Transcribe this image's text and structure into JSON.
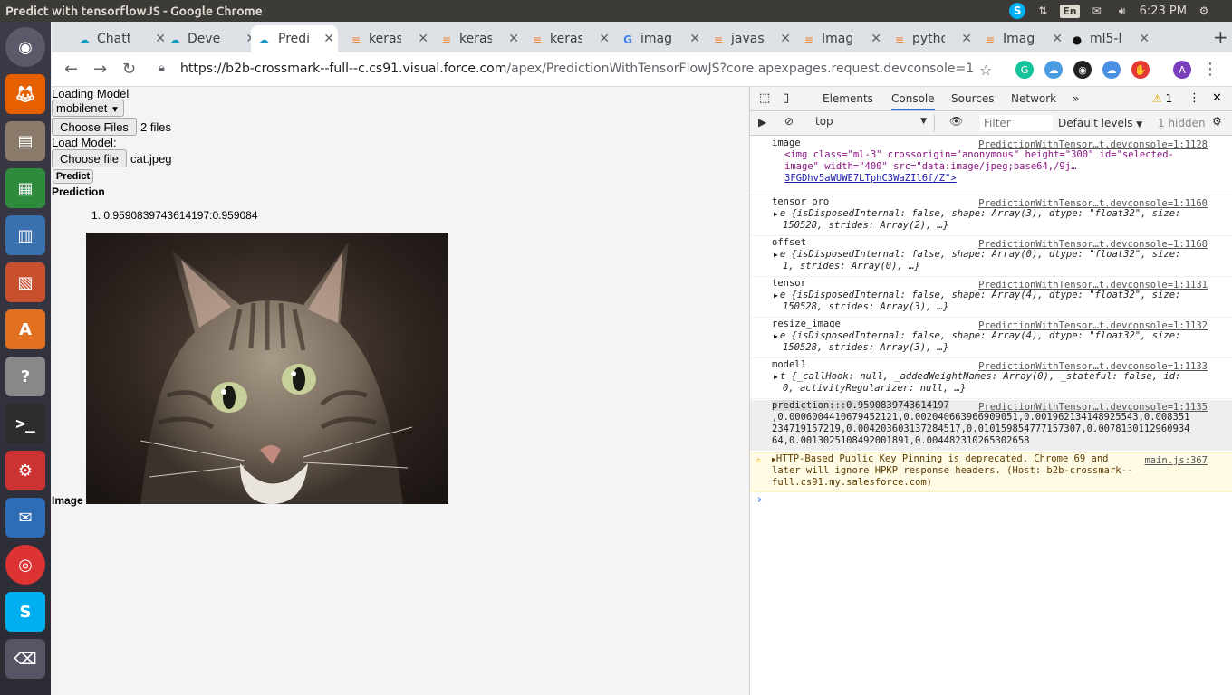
{
  "window": {
    "title": "Predict with tensorflowJS - Google Chrome"
  },
  "tray": {
    "time": "6:23 PM",
    "keyboard": "En"
  },
  "tabs": [
    {
      "label": "Chatt",
      "icon": "salesforce-icon"
    },
    {
      "label": "Deve",
      "icon": "salesforce-icon"
    },
    {
      "label": "Predi",
      "icon": "salesforce-icon"
    },
    {
      "label": "keras",
      "icon": "stackoverflow-icon"
    },
    {
      "label": "keras",
      "icon": "stackoverflow-icon"
    },
    {
      "label": "keras",
      "icon": "stackoverflow-icon"
    },
    {
      "label": "imag",
      "icon": "google-icon"
    },
    {
      "label": "javas",
      "icon": "stackoverflow-icon"
    },
    {
      "label": "Imag",
      "icon": "stackoverflow-icon"
    },
    {
      "label": "pytho",
      "icon": "stackoverflow-icon"
    },
    {
      "label": "Imag",
      "icon": "stackoverflow-icon"
    },
    {
      "label": "ml5-l",
      "icon": "github-icon"
    }
  ],
  "address": {
    "host": "https://b2b-crossmark--full--c.cs91.visual.force.com",
    "path": "/apex/PredictionWithTensorFlowJS?core.apexpages.request.devconsole=1"
  },
  "page": {
    "loading_label": "Loading Model",
    "model_select": "mobilenet",
    "choose_files_label": "Choose Files",
    "files_count": "2 files",
    "load_model_label": "Load Model:",
    "choose_file_label": "Choose file",
    "file_name": "cat.jpeg",
    "predict_label": "Predict",
    "prediction_heading": "Prediction",
    "prediction_item": "0.9590839743614197:0.959084",
    "image_label": "Image"
  },
  "devtools": {
    "tabs": [
      "Elements",
      "Console",
      "Sources",
      "Network"
    ],
    "warnings_count": "1",
    "context": "top",
    "filter_placeholder": "Filter",
    "levels": "Default levels",
    "hidden": "1 hidden",
    "logs": [
      {
        "label": "image",
        "source": "PredictionWithTensor…t.devconsole=1:1128",
        "line1": "<img class=\"ml-3\" crossorigin=\"anonymous\" height=\"300\" id=\"selected-",
        "line2": "image\" width=\"400\" src=\"data:image/jpeg;base64,/9j…",
        "line3": "3FGDhv5aWUWE7LTphC3WaZIl6f/Z\">"
      },
      {
        "label": "tensor pro",
        "source": "PredictionWithTensor…t.devconsole=1:1160",
        "line1": "e {isDisposedInternal: false, shape: Array(3), dtype: \"float32\", size:",
        "line2": "150528, strides: Array(2), …}"
      },
      {
        "label": "offset",
        "source": "PredictionWithTensor…t.devconsole=1:1168",
        "line1": "e {isDisposedInternal: false, shape: Array(0), dtype: \"float32\", size:",
        "line2": "1, strides: Array(0), …}"
      },
      {
        "label": "tensor",
        "source": "PredictionWithTensor…t.devconsole=1:1131",
        "line1": "e {isDisposedInternal: false, shape: Array(4), dtype: \"float32\", size:",
        "line2": "150528, strides: Array(3), …}"
      },
      {
        "label": "resize_image",
        "source": "PredictionWithTensor…t.devconsole=1:1132",
        "line1": "e {isDisposedInternal: false, shape: Array(4), dtype: \"float32\", size:",
        "line2": "150528, strides: Array(3), …}"
      },
      {
        "label": "model1",
        "source": "PredictionWithTensor…t.devconsole=1:1133",
        "line1": "t {_callHook: null, _addedWeightNames: Array(0), _stateful: false, id:",
        "line2": "0, activityRegularizer: null, …}"
      },
      {
        "label": "prediction:::0.9590839743614197",
        "source": "PredictionWithTensor…t.devconsole=1:1135",
        "line1": ",0.0006004410679452121,0.002040663966909051,0.001962134148925543,0.008351",
        "line2": "234719157219,0.004203603137284517,0.010159854777157307,0.0078130112960934",
        "line3": "64,0.0013025108492001891,0.004482310265302658"
      },
      {
        "label": "HTTP-Based Public Key Pinning is deprecated. Chrome 69 and",
        "source": "main.js:367",
        "line1": "later will ignore HPKP response headers. (Host: b2b-crossmark--",
        "line2": "full.cs91.my.salesforce.com)"
      }
    ]
  }
}
